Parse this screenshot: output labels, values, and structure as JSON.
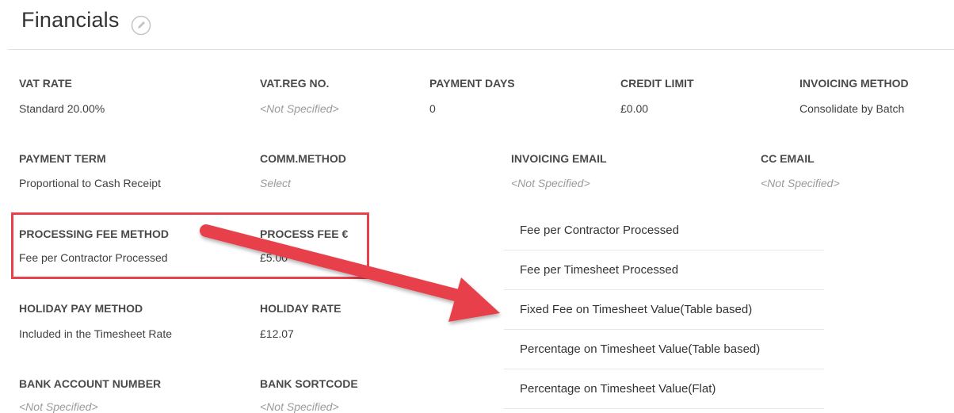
{
  "header": {
    "title": "Financials",
    "edit_icon": "pencil-icon"
  },
  "fields": {
    "vat_rate": {
      "label": "VAT RATE",
      "value": "Standard 20.00%"
    },
    "vat_reg_no": {
      "label": "VAT.REG NO.",
      "value": "<Not Specified>"
    },
    "payment_days": {
      "label": "PAYMENT DAYS",
      "value": "0"
    },
    "credit_limit": {
      "label": "CREDIT LIMIT",
      "value": "£0.00"
    },
    "invoicing_method": {
      "label": "INVOICING METHOD",
      "value": "Consolidate by Batch"
    },
    "payment_term": {
      "label": "PAYMENT TERM",
      "value": "Proportional to Cash Receipt"
    },
    "comm_method": {
      "label": "COMM.METHOD",
      "value": "Select"
    },
    "invoicing_email": {
      "label": "INVOICING EMAIL",
      "value": "<Not Specified>"
    },
    "cc_email": {
      "label": "CC EMAIL",
      "value": "<Not Specified>"
    },
    "processing_fee_method": {
      "label": "PROCESSING FEE METHOD",
      "value": "Fee per Contractor Processed"
    },
    "process_fee": {
      "label": "PROCESS FEE €",
      "value": "£5.00"
    },
    "holiday_pay_method": {
      "label": "HOLIDAY PAY METHOD",
      "value": "Included in the Timesheet Rate"
    },
    "holiday_rate": {
      "label": "HOLIDAY RATE",
      "value": "£12.07"
    },
    "bank_account_number": {
      "label": "BANK ACCOUNT NUMBER",
      "value": "<Not Specified>"
    },
    "bank_sortcode": {
      "label": "BANK SORTCODE",
      "value": "<Not Specified>"
    }
  },
  "fee_method_dropdown": {
    "options": [
      "Fee per Contractor Processed",
      "Fee per Timesheet Processed",
      "Fixed Fee on Timesheet Value(Table based)",
      "Percentage on Timesheet Value(Table based)",
      "Percentage on Timesheet Value(Flat)"
    ]
  },
  "annotation": {
    "highlight_color": "#e8414b",
    "arrow_color": "#e8414b"
  }
}
